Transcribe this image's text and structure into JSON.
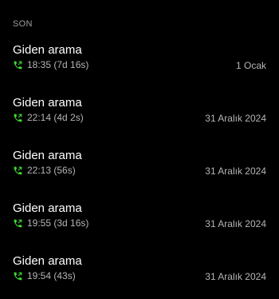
{
  "section": {
    "label": "SON"
  },
  "colors": {
    "outgoing_icon": "#3ddc2c",
    "background": "#000000"
  },
  "calls": [
    {
      "title": "Giden arama",
      "icon": "outgoing-call-icon",
      "time": "18:35 (7d 16s)",
      "date": "1 Ocak"
    },
    {
      "title": "Giden arama",
      "icon": "outgoing-call-icon",
      "time": "22:14 (4d 2s)",
      "date": "31 Aralık 2024"
    },
    {
      "title": "Giden arama",
      "icon": "outgoing-call-icon",
      "time": "22:13 (56s)",
      "date": "31 Aralık 2024"
    },
    {
      "title": "Giden arama",
      "icon": "outgoing-call-icon",
      "time": "19:55 (3d 16s)",
      "date": "31 Aralık 2024"
    },
    {
      "title": "Giden arama",
      "icon": "outgoing-call-icon",
      "time": "19:54 (43s)",
      "date": "31 Aralık 2024"
    }
  ]
}
